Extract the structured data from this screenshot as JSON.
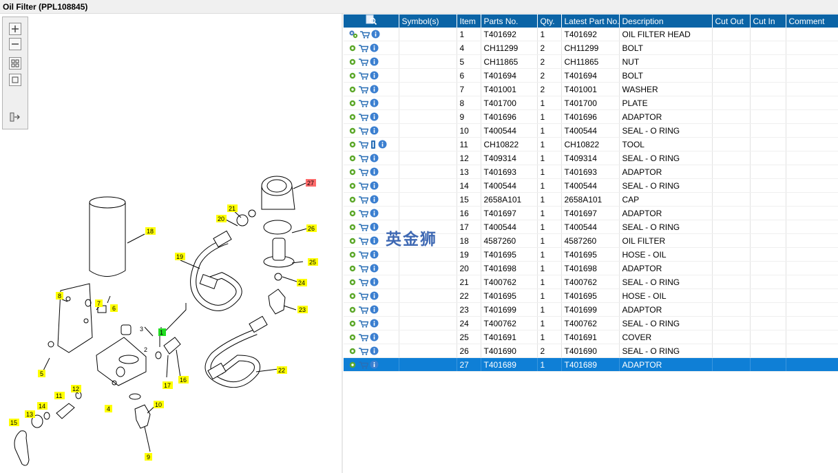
{
  "window": {
    "title": "Oil Filter (PPL108845)"
  },
  "toolbar": {
    "buttons": [
      "zoom-in-icon",
      "zoom-out-icon",
      "fit-all-icon",
      "actual-size-icon",
      "export-list-icon"
    ]
  },
  "diagram": {
    "callouts": [
      "1",
      "2",
      "3",
      "4",
      "5",
      "6",
      "7",
      "8",
      "9",
      "10",
      "11",
      "12",
      "13",
      "14",
      "15",
      "16",
      "17",
      "18",
      "19",
      "20",
      "21",
      "22",
      "23",
      "24",
      "25",
      "26",
      "27"
    ],
    "highlight_colors": {
      "yellow": "#ffff00",
      "green": "#22dd22",
      "red": "#ff6b6b"
    }
  },
  "watermark": "英金狮",
  "table": {
    "columns": [
      "Symbol(s)",
      "Item",
      "Parts No.",
      "Qty.",
      "Latest Part No.",
      "Description",
      "Cut Out",
      "Cut In",
      "Comment"
    ],
    "rows": [
      {
        "item": "1",
        "part": "T401692",
        "qty": "1",
        "latest": "T401692",
        "desc": "OIL FILTER HEAD"
      },
      {
        "item": "4",
        "part": "CH11299",
        "qty": "2",
        "latest": "CH11299",
        "desc": "BOLT"
      },
      {
        "item": "5",
        "part": "CH11865",
        "qty": "2",
        "latest": "CH11865",
        "desc": "NUT"
      },
      {
        "item": "6",
        "part": "T401694",
        "qty": "2",
        "latest": "T401694",
        "desc": "BOLT"
      },
      {
        "item": "7",
        "part": "T401001",
        "qty": "2",
        "latest": "T401001",
        "desc": "WASHER"
      },
      {
        "item": "8",
        "part": "T401700",
        "qty": "1",
        "latest": "T401700",
        "desc": "PLATE"
      },
      {
        "item": "9",
        "part": "T401696",
        "qty": "1",
        "latest": "T401696",
        "desc": "ADAPTOR"
      },
      {
        "item": "10",
        "part": "T400544",
        "qty": "1",
        "latest": "T400544",
        "desc": "SEAL - O RING"
      },
      {
        "item": "11",
        "part": "CH10822",
        "qty": "1",
        "latest": "CH10822",
        "desc": "TOOL"
      },
      {
        "item": "12",
        "part": "T409314",
        "qty": "1",
        "latest": "T409314",
        "desc": "SEAL - O RING"
      },
      {
        "item": "13",
        "part": "T401693",
        "qty": "1",
        "latest": "T401693",
        "desc": "ADAPTOR"
      },
      {
        "item": "14",
        "part": "T400544",
        "qty": "1",
        "latest": "T400544",
        "desc": "SEAL - O RING"
      },
      {
        "item": "15",
        "part": "2658A101",
        "qty": "1",
        "latest": "2658A101",
        "desc": "CAP"
      },
      {
        "item": "16",
        "part": "T401697",
        "qty": "1",
        "latest": "T401697",
        "desc": "ADAPTOR"
      },
      {
        "item": "17",
        "part": "T400544",
        "qty": "1",
        "latest": "T400544",
        "desc": "SEAL - O RING"
      },
      {
        "item": "18",
        "part": "4587260",
        "qty": "1",
        "latest": "4587260",
        "desc": "OIL FILTER"
      },
      {
        "item": "19",
        "part": "T401695",
        "qty": "1",
        "latest": "T401695",
        "desc": "HOSE - OIL"
      },
      {
        "item": "20",
        "part": "T401698",
        "qty": "1",
        "latest": "T401698",
        "desc": "ADAPTOR"
      },
      {
        "item": "21",
        "part": "T400762",
        "qty": "1",
        "latest": "T400762",
        "desc": "SEAL - O RING"
      },
      {
        "item": "22",
        "part": "T401695",
        "qty": "1",
        "latest": "T401695",
        "desc": "HOSE - OIL"
      },
      {
        "item": "23",
        "part": "T401699",
        "qty": "1",
        "latest": "T401699",
        "desc": "ADAPTOR"
      },
      {
        "item": "24",
        "part": "T400762",
        "qty": "1",
        "latest": "T400762",
        "desc": "SEAL - O RING"
      },
      {
        "item": "25",
        "part": "T401691",
        "qty": "1",
        "latest": "T401691",
        "desc": "COVER"
      },
      {
        "item": "26",
        "part": "T401690",
        "qty": "2",
        "latest": "T401690",
        "desc": "SEAL - O RING"
      },
      {
        "item": "27",
        "part": "T401689",
        "qty": "1",
        "latest": "T401689",
        "desc": "ADAPTOR"
      }
    ],
    "selected_item": "27",
    "colors": {
      "header": "#0b64a6",
      "selected": "#0f7fd6"
    }
  }
}
